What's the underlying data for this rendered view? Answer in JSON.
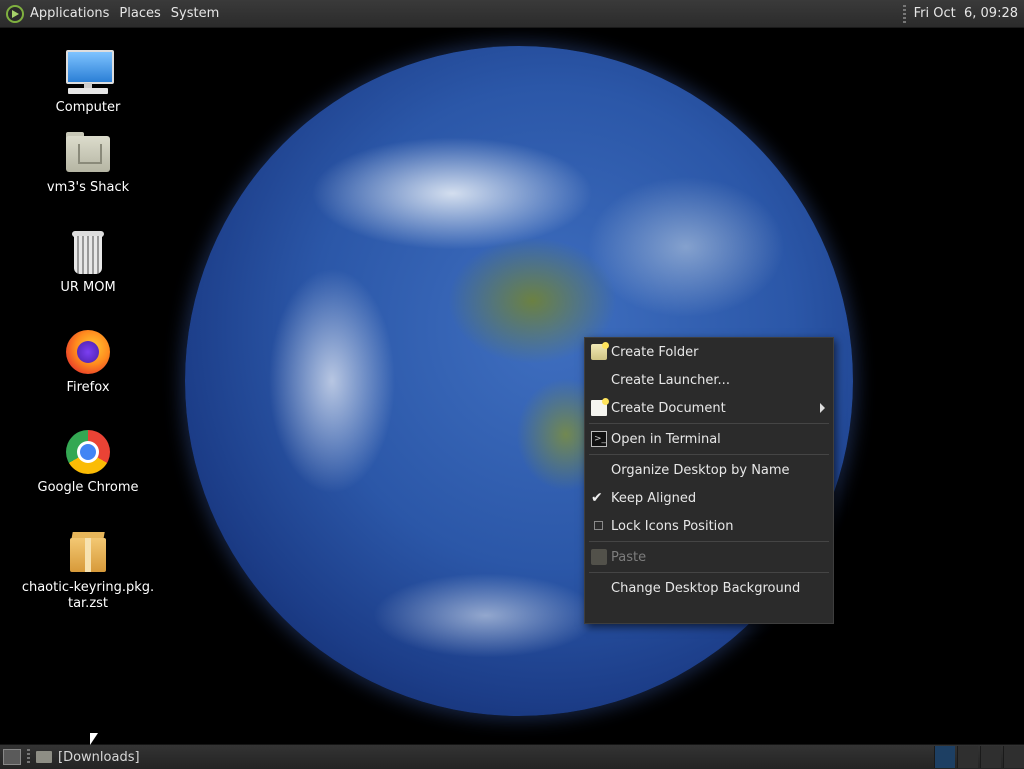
{
  "top_panel": {
    "menus": [
      "Applications",
      "Places",
      "System"
    ],
    "clock": "Fri Oct  6, 09:28"
  },
  "desktop_icons": [
    {
      "label": "Computer",
      "icon": "computer-icon"
    },
    {
      "label": "vm3's Shack",
      "icon": "home-folder-icon"
    },
    {
      "label": "UR MOM",
      "icon": "trash-icon"
    },
    {
      "label": "Firefox",
      "icon": "firefox-icon"
    },
    {
      "label": "Google Chrome",
      "icon": "chrome-icon"
    },
    {
      "label": "chaotic-keyring.pkg.\ntar.zst",
      "line1": "chaotic-keyring.pkg.",
      "line2": "tar.zst",
      "icon": "package-icon"
    }
  ],
  "context_menu": {
    "items": [
      {
        "label": "Create Folder",
        "icon": "new-folder-icon"
      },
      {
        "label": "Create Launcher...",
        "icon": ""
      },
      {
        "label": "Create Document",
        "icon": "new-document-icon",
        "submenu": true
      },
      {
        "label": "Open in Terminal",
        "icon": "terminal-icon"
      },
      {
        "label": "Organize Desktop by Name",
        "icon": ""
      },
      {
        "label": "Keep Aligned",
        "icon": "checkmark-icon",
        "checked": true
      },
      {
        "label": "Lock Icons Position",
        "icon": "checkbox-icon",
        "checked": false
      },
      {
        "label": "Paste",
        "icon": "paste-icon",
        "disabled": true
      },
      {
        "label": "Change Desktop Background",
        "icon": ""
      }
    ]
  },
  "bottom_panel": {
    "task_label": "[Downloads]"
  }
}
